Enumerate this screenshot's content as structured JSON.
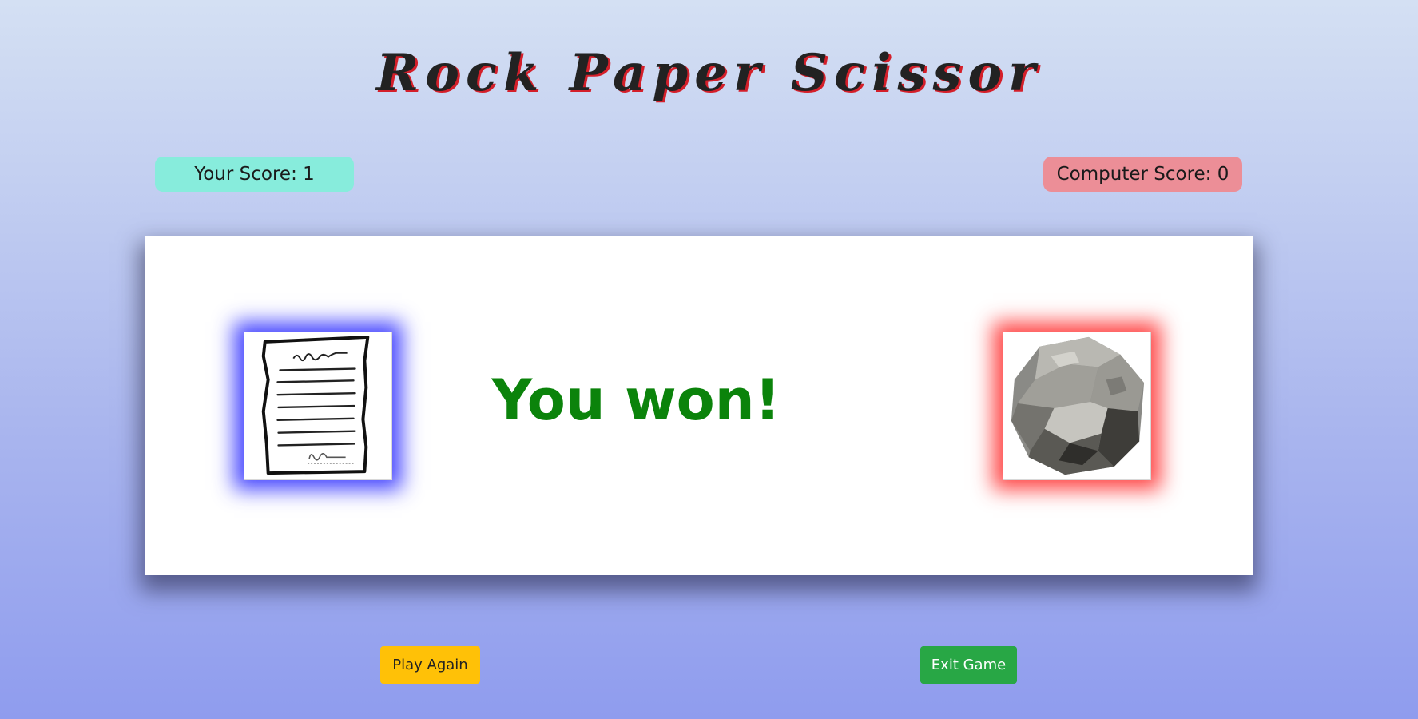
{
  "game": {
    "title": "Rock Paper Scissor",
    "player_score_label": "Your Score: 1",
    "computer_score_label": "Computer Score: 0",
    "player_score": 1,
    "computer_score": 0,
    "player_choice": "paper",
    "computer_choice": "rock",
    "result_text": "You won!",
    "colors": {
      "player_glow": "#2828ff",
      "computer_glow": "#ff2828",
      "result": "#0b830b",
      "player_score_bg": "#87ecdc",
      "computer_score_bg": "#ec8e97"
    }
  },
  "buttons": {
    "play_again": "Play Again",
    "exit_game": "Exit Game"
  },
  "icons": {
    "player": "paper-document-icon",
    "computer": "rock-icon"
  }
}
